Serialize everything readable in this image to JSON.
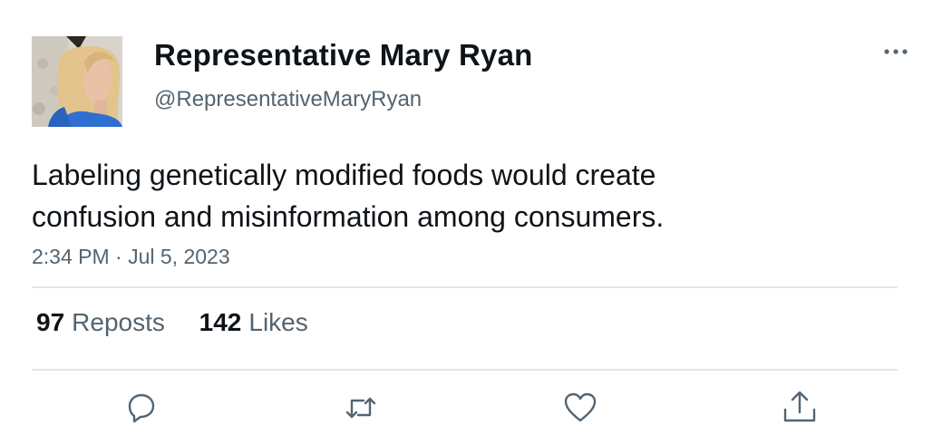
{
  "author": {
    "display_name": "Representative Mary Ryan",
    "handle": "@RepresentativeMaryRyan"
  },
  "tweet": {
    "text_line1": "Labeling genetically modified foods would create",
    "text_line2": "confusion and misinformation among consumers.",
    "timestamp": "2:34 PM · Jul 5, 2023"
  },
  "stats": {
    "reposts_count": "97",
    "reposts_label": "Reposts",
    "likes_count": "142",
    "likes_label": "Likes"
  },
  "icons": {
    "more": "more-horizontal-icon",
    "reply": "reply-icon",
    "repost": "repost-icon",
    "like": "heart-icon",
    "share": "share-icon"
  },
  "colors": {
    "text_primary": "#0f1419",
    "text_secondary": "#536471",
    "divider": "#e1e5e8",
    "icon": "#536471"
  }
}
